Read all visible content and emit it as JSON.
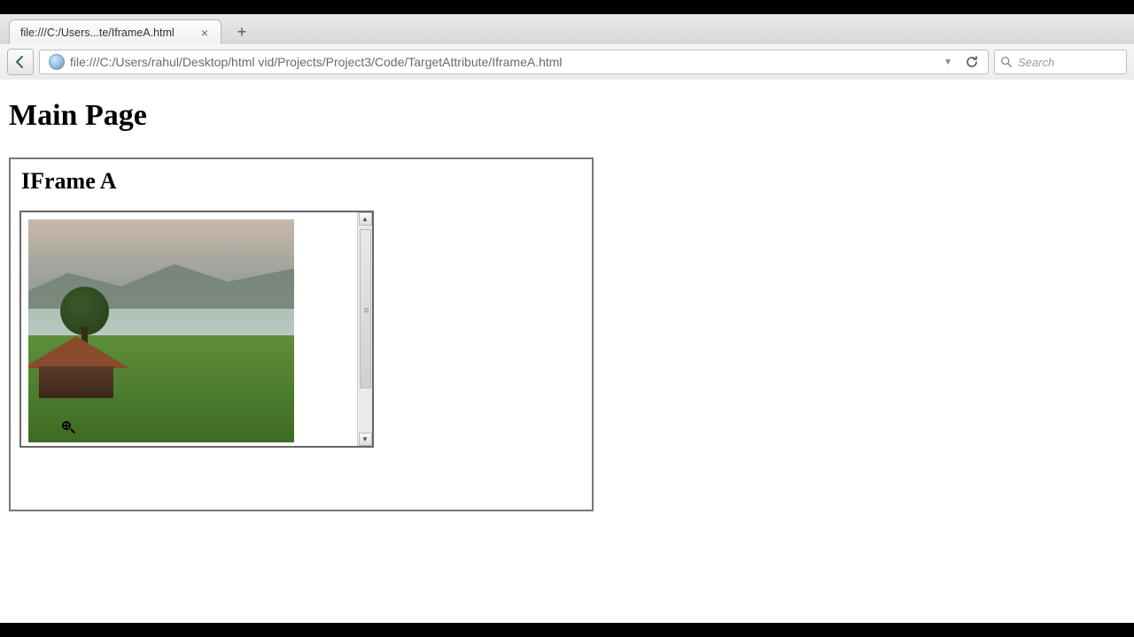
{
  "browser": {
    "tab_title": "file:///C:/Users...te/IframeA.html",
    "url": "file:///C:/Users/rahul/Desktop/html vid/Projects/Project3/Code/TargetAttribute/IframeA.html",
    "search_placeholder": "Search"
  },
  "page": {
    "heading": "Main Page",
    "iframe_a": {
      "heading": "IFrame A"
    }
  }
}
